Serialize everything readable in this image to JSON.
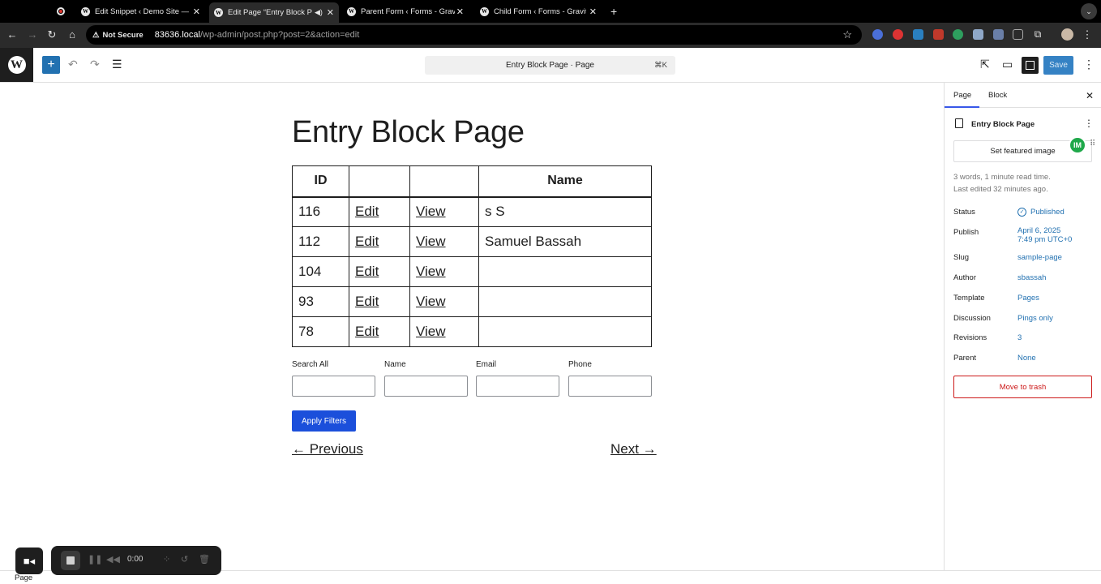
{
  "browser": {
    "tabs": [
      {
        "title": "",
        "icon": "record-icon",
        "active": false
      },
      {
        "title": "Edit Snippet ‹ Demo Site — W",
        "icon": "wordpress-icon",
        "active": false
      },
      {
        "title": "Edit Page “Entry Block Pa",
        "icon": "wordpress-icon",
        "active": true
      },
      {
        "title": "Parent Form ‹ Forms - Gravity",
        "icon": "wordpress-icon",
        "active": false
      },
      {
        "title": "Child Form ‹ Forms - Gravity",
        "icon": "wordpress-icon",
        "active": false
      }
    ],
    "security_label": "Not Secure",
    "url_host": "83636.local",
    "url_path": "/wp-admin/post.php?post=2&action=edit"
  },
  "editor": {
    "command_title": "Entry Block Page · Page",
    "command_shortcut": "⌘K",
    "save_label": "Save"
  },
  "page": {
    "title": "Entry Block Page",
    "table": {
      "headers": [
        "ID",
        "",
        "",
        "Name"
      ],
      "rows": [
        [
          "116",
          "Edit",
          "View",
          "s S"
        ],
        [
          "112",
          "Edit",
          "View",
          "Samuel Bassah"
        ],
        [
          "104",
          "Edit",
          "View",
          ""
        ],
        [
          "93",
          "Edit",
          "View",
          ""
        ],
        [
          "78",
          "Edit",
          "View",
          ""
        ]
      ]
    },
    "filters": {
      "search_all_label": "Search All",
      "name_label": "Name",
      "email_label": "Email",
      "phone_label": "Phone",
      "apply_label": "Apply Filters"
    },
    "prev_label": "← Previous",
    "next_label": "Next →"
  },
  "sidebar": {
    "tab_page": "Page",
    "tab_block": "Block",
    "doc_title": "Entry Block Page",
    "featured_label": "Set featured image",
    "badge_text": "IM",
    "meta_line1": "3 words, 1 minute read time.",
    "meta_line2": "Last edited 32 minutes ago.",
    "status_label": "Status",
    "status_value": "Published",
    "publish_label": "Publish",
    "publish_date": "April 6, 2025",
    "publish_time": "7:49 pm UTC+0",
    "slug_label": "Slug",
    "slug_value": "sample-page",
    "author_label": "Author",
    "author_value": "sbassah",
    "template_label": "Template",
    "template_value": "Pages",
    "discussion_label": "Discussion",
    "discussion_value": "Pings only",
    "revisions_label": "Revisions",
    "revisions_value": "3",
    "parent_label": "Parent",
    "parent_value": "None",
    "trash_label": "Move to trash"
  },
  "footer": {
    "breadcrumb": "Page"
  },
  "recorder": {
    "time": "0:00"
  },
  "colors": {
    "accent": "#3858e9",
    "wp_blue": "#2271b1",
    "apply_button": "#1b4fdb",
    "danger": "#cc1818"
  }
}
